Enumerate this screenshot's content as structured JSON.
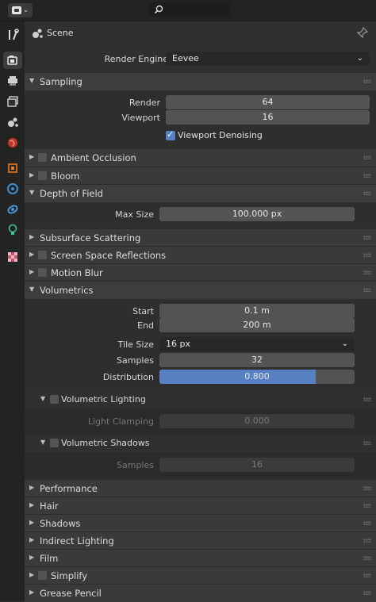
{
  "scene_title": "Scene",
  "render_engine": {
    "label": "Render Engine",
    "value": "Eevee"
  },
  "sampling": {
    "title": "Sampling",
    "render_label": "Render",
    "render_value": "64",
    "viewport_label": "Viewport",
    "viewport_value": "16",
    "denoise_label": "Viewport Denoising"
  },
  "sections_closed_top": [
    "Ambient Occlusion",
    "Bloom"
  ],
  "dof": {
    "title": "Depth of Field",
    "max_size_label": "Max Size",
    "max_size_value": "100.000 px"
  },
  "closed_mid": [
    "Subsurface Scattering",
    "Screen Space Reflections",
    "Motion Blur"
  ],
  "volumetrics": {
    "title": "Volumetrics",
    "start_label": "Start",
    "start_value": "0.1 m",
    "end_label": "End",
    "end_value": "200 m",
    "tile_label": "Tile Size",
    "tile_value": "16 px",
    "samples_label": "Samples",
    "samples_value": "32",
    "dist_label": "Distribution",
    "dist_value": "0.800",
    "dist_fraction": 0.8,
    "lighting_title": "Volumetric Lighting",
    "clamp_label": "Light Clamping",
    "clamp_value": "0.000",
    "shadows_title": "Volumetric Shadows",
    "shadow_samples_label": "Samples",
    "shadow_samples_value": "16"
  },
  "closed_bottom": [
    "Performance",
    "Hair",
    "Shadows",
    "Indirect Lighting",
    "Film",
    "Simplify",
    "Grease Pencil"
  ],
  "colors": {
    "accent": "#5680c2",
    "panel": "#303030",
    "field": "#545454"
  }
}
